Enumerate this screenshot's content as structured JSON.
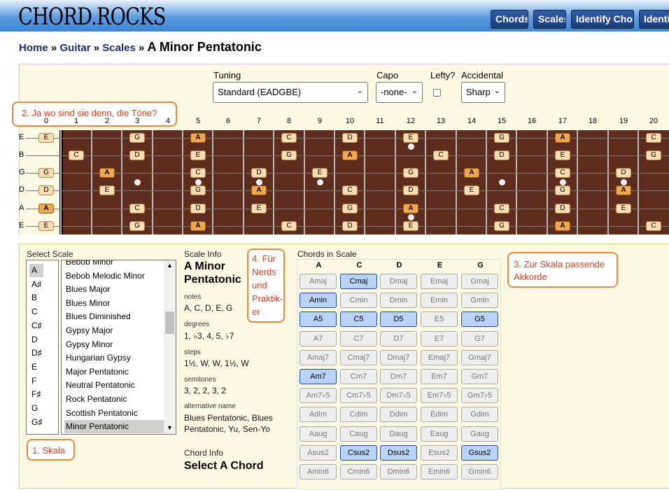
{
  "header": {
    "logo": "CHORD.ROCKS",
    "nav": [
      "Chords",
      "Scales",
      "Identify Chord",
      "Identify Scale"
    ]
  },
  "breadcrumb": {
    "home": "Home",
    "sep1": "»",
    "guitar": "Guitar",
    "sep2": "»",
    "scales": "Scales",
    "sep3": "»",
    "current": "A Minor Pentatonic"
  },
  "settings": {
    "tuning_label": "Tuning",
    "tuning_value": "Standard (EADGBE)",
    "capo_label": "Capo",
    "capo_value": "-none-",
    "lefty_label": "Lefty?",
    "accidental_label": "Accidental",
    "accidental_value": "Sharp"
  },
  "frets": [
    "0",
    "1",
    "2",
    "3",
    "4",
    "5",
    "6",
    "7",
    "8",
    "9",
    "10",
    "11",
    "12",
    "13",
    "14",
    "15",
    "16",
    "17",
    "18",
    "19",
    "20"
  ],
  "strings": [
    "E",
    "B",
    "G",
    "D",
    "A",
    "E"
  ],
  "select_scale": {
    "label": "Select Scale",
    "roots": [
      "A",
      "A♯",
      "B",
      "C",
      "C♯",
      "D",
      "D♯",
      "E",
      "F",
      "F♯",
      "G",
      "G♯"
    ],
    "selected_root": "A",
    "scales": [
      "Bebob Minor",
      "Bebob Melodic Minor",
      "Blues Major",
      "Blues Minor",
      "Blues Diminished",
      "Gypsy Major",
      "Gypsy Minor",
      "Hungarian Gypsy",
      "Major Pentatonic",
      "Neutral Pentatonic",
      "Rock Pentatonic",
      "Scottish Pentatonic",
      "Minor Pentatonic"
    ],
    "selected_scale": "Minor Pentatonic"
  },
  "scale_info": {
    "label": "Scale Info",
    "name_line1": "A Minor",
    "name_line2": "Pentatonic",
    "notes_label": "notes",
    "notes": "A, C, D, E, G",
    "degrees_label": "degrees",
    "degrees": "1, ♭3, 4, 5, ♭7",
    "steps_label": "steps",
    "steps": "1½, W, W, 1½, W",
    "semitones_label": "semitones",
    "semitones": "3, 2, 2, 3, 2",
    "alt_label": "alternative name",
    "alt_line1": "Blues Pentatonic, Blues",
    "alt_line2": "Pentatonic, Yu, Sen-Yo"
  },
  "chord_info": {
    "label": "Chord Info",
    "value": "Select A Chord"
  },
  "chords_in_scale": {
    "label": "Chords in Scale",
    "columns": [
      "A",
      "C",
      "D",
      "E",
      "G"
    ],
    "rows": [
      [
        [
          "Amaj",
          0
        ],
        [
          "Cmaj",
          1
        ],
        [
          "Dmaj",
          0
        ],
        [
          "Emaj",
          0
        ],
        [
          "Gmaj",
          0
        ]
      ],
      [
        [
          "Amin",
          1
        ],
        [
          "Cmin",
          0
        ],
        [
          "Dmin",
          0
        ],
        [
          "Emin",
          0
        ],
        [
          "Gmin",
          0
        ]
      ],
      [
        [
          "A5",
          1
        ],
        [
          "C5",
          1
        ],
        [
          "D5",
          1
        ],
        [
          "E5",
          0
        ],
        [
          "G5",
          1
        ]
      ],
      [
        [
          "A7",
          0
        ],
        [
          "C7",
          0
        ],
        [
          "D7",
          0
        ],
        [
          "E7",
          0
        ],
        [
          "G7",
          0
        ]
      ],
      [
        [
          "Amaj7",
          0
        ],
        [
          "Cmaj7",
          0
        ],
        [
          "Dmaj7",
          0
        ],
        [
          "Emaj7",
          0
        ],
        [
          "Gmaj7",
          0
        ]
      ],
      [
        [
          "Am7",
          1
        ],
        [
          "Cm7",
          0
        ],
        [
          "Dm7",
          0
        ],
        [
          "Em7",
          0
        ],
        [
          "Gm7",
          0
        ]
      ],
      [
        [
          "Am7♭5",
          0
        ],
        [
          "Cm7♭5",
          0
        ],
        [
          "Dm7♭5",
          0
        ],
        [
          "Em7♭5",
          0
        ],
        [
          "Gm7♭5",
          0
        ]
      ],
      [
        [
          "Adim",
          0
        ],
        [
          "Cdim",
          0
        ],
        [
          "Ddim",
          0
        ],
        [
          "Edim",
          0
        ],
        [
          "Gdim",
          0
        ]
      ],
      [
        [
          "Aaug",
          0
        ],
        [
          "Caug",
          0
        ],
        [
          "Daug",
          0
        ],
        [
          "Eaug",
          0
        ],
        [
          "Gaug",
          0
        ]
      ],
      [
        [
          "Asus2",
          0
        ],
        [
          "Csus2",
          1
        ],
        [
          "Dsus2",
          1
        ],
        [
          "Esus2",
          0
        ],
        [
          "Gsus2",
          1
        ]
      ],
      [
        [
          "Amin6",
          0
        ],
        [
          "Cmin6",
          0
        ],
        [
          "Dmin6",
          0
        ],
        [
          "Emin6",
          0
        ],
        [
          "Gmin6",
          0
        ]
      ]
    ]
  },
  "annotations": {
    "a1": "1. Skala",
    "a2": "2. Ja wo sind sie denn, die Töne?",
    "a3_line1": "3. Zur Skala passende",
    "a3_line2": "Akkorde",
    "a4_lines": [
      "4. Für",
      "Nerds",
      "und",
      "Praktik-",
      "er"
    ]
  },
  "colors": {
    "root_note": "#f0a84a",
    "note": "#f8ddb0",
    "fretboard": "#5e2c1d",
    "chord_on": "#b9d3f7",
    "annotation": "#e03c1f"
  }
}
